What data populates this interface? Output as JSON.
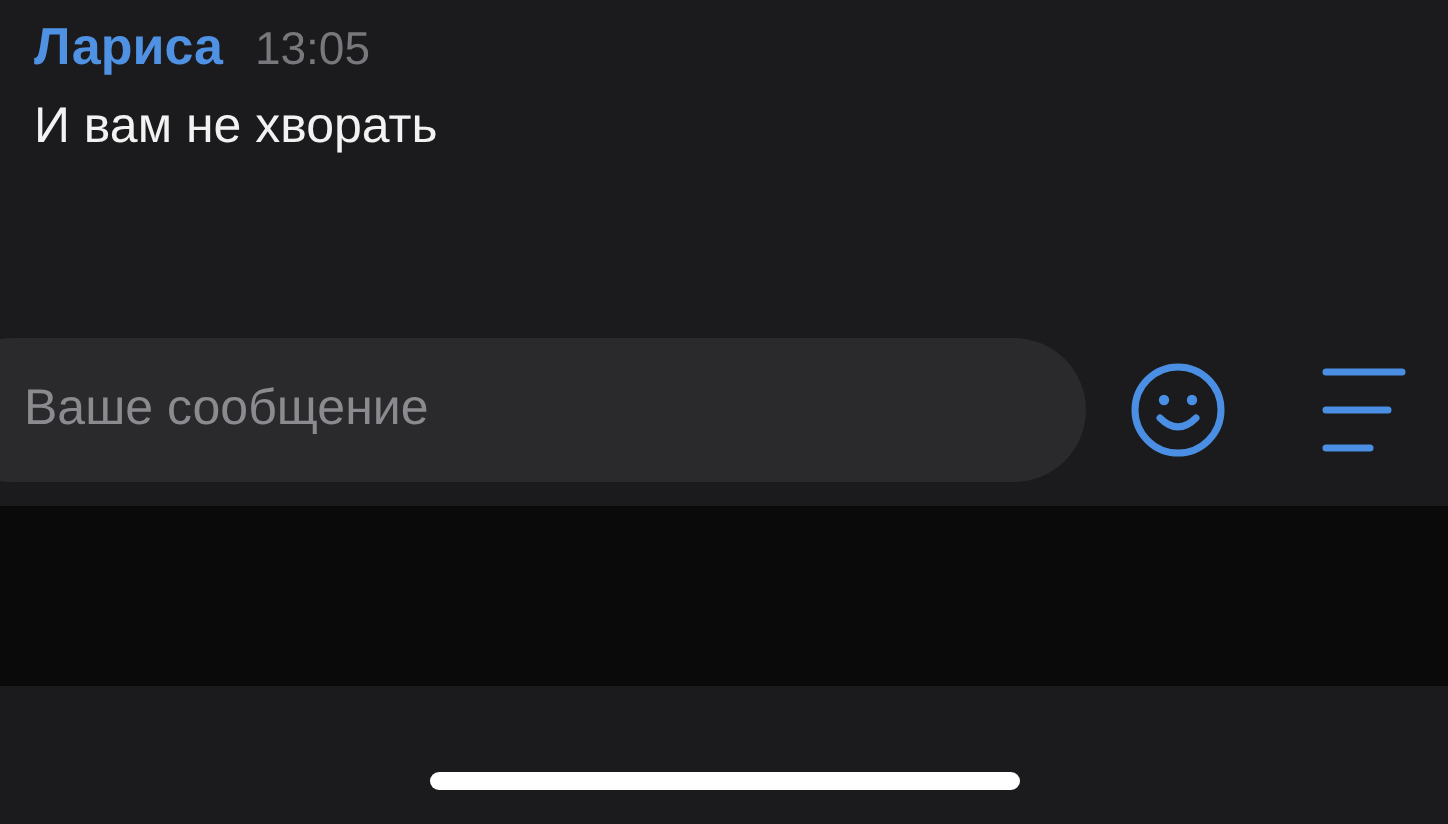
{
  "message": {
    "author": "Лариса",
    "time": "13:05",
    "text": "И вам не хворать"
  },
  "composer": {
    "placeholder": "Ваше сообщение"
  }
}
